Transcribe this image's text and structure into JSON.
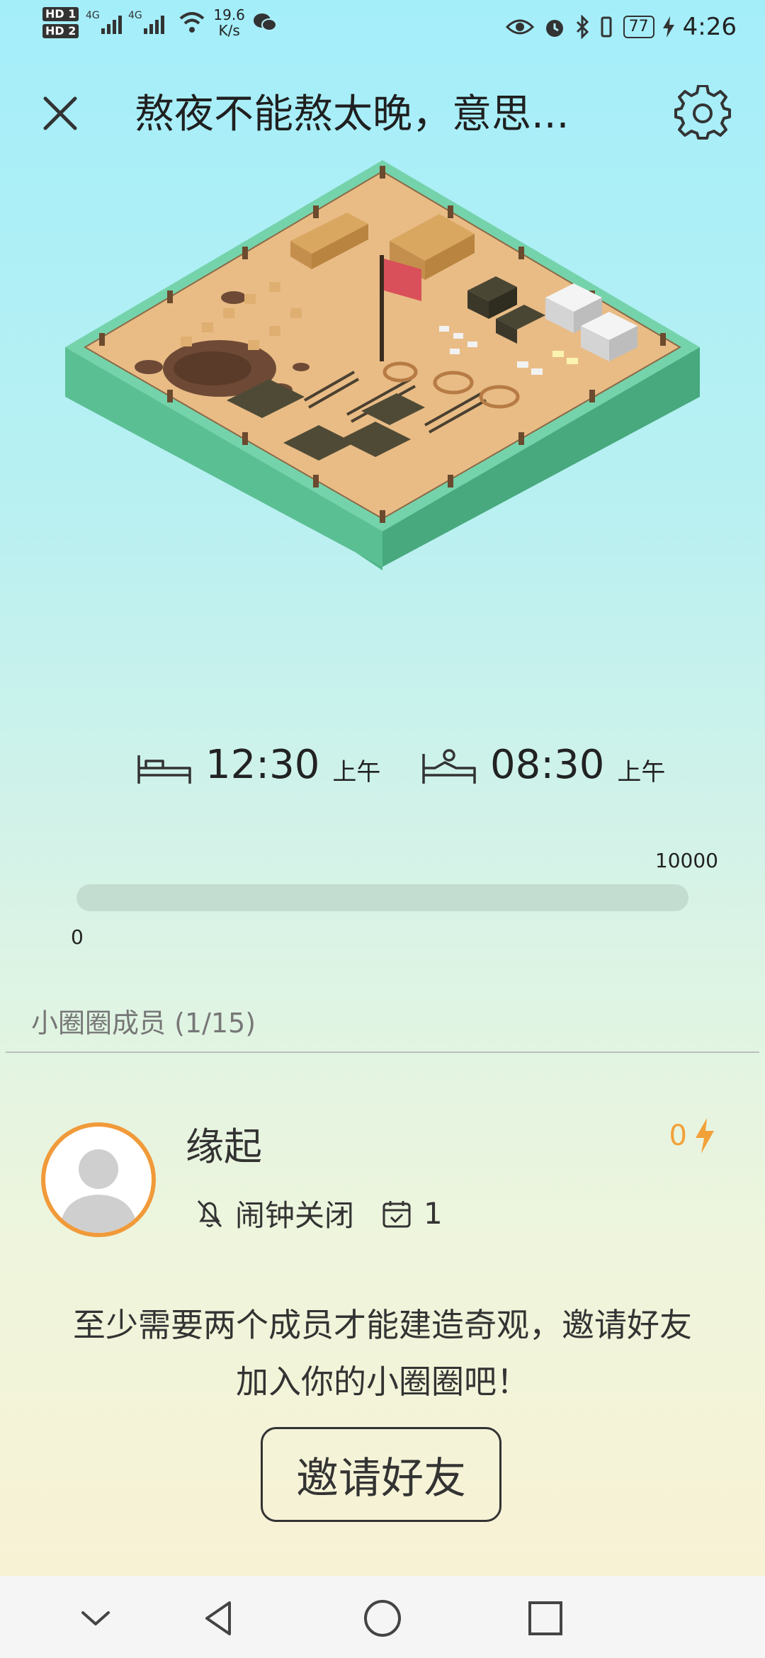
{
  "status_bar": {
    "hd1": "HD 1",
    "hd2": "HD 2",
    "network": "4G",
    "speed_value": "19.6",
    "speed_unit": "K/s",
    "battery": "77",
    "time": "4:26"
  },
  "header": {
    "title": "熬夜不能熬太晚，意思...",
    "close_icon": "close-icon",
    "settings_icon": "gear-icon"
  },
  "sleep": {
    "bedtime": "12:30",
    "bedtime_ampm": "上午",
    "wake_time": "08:30",
    "wake_ampm": "上午"
  },
  "progress": {
    "min_label": "0",
    "max_label": "10000",
    "value": 0,
    "max": 10000
  },
  "members": {
    "header": "小圈圈成员 (1/15)",
    "list": [
      {
        "name": "缘起",
        "energy": "0",
        "alarm_status": "闹钟关闭",
        "check_count": "1"
      }
    ]
  },
  "invite": {
    "message_line1": "至少需要两个成员才能建造奇观，邀请好友",
    "message_line2": "加入你的小圈圈吧！",
    "button_label": "邀请好友"
  },
  "colors": {
    "accent_orange": "#f2a138",
    "sand": "#e9bc86",
    "platform_green": "#5fc59b"
  }
}
